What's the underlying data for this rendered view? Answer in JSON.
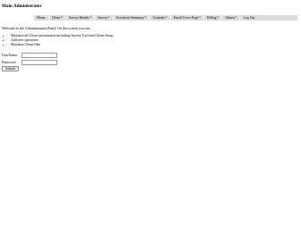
{
  "app": {
    "title": "Main Administrator"
  },
  "nav": {
    "items": [
      {
        "label": "Home",
        "has_caret": false
      },
      {
        "label": "Client",
        "has_caret": true
      },
      {
        "label": "Survey Results",
        "has_caret": true
      },
      {
        "label": "Survey",
        "has_caret": true
      },
      {
        "label": "Executive Summary",
        "has_caret": true
      },
      {
        "label": "Generate",
        "has_caret": true
      },
      {
        "label": "Email Cover Page",
        "has_caret": true
      },
      {
        "label": "Billing",
        "has_caret": true
      },
      {
        "label": "Admin",
        "has_caret": true
      },
      {
        "label": "Log Out",
        "has_caret": false
      }
    ],
    "caret_glyph": "▾"
  },
  "main": {
    "welcome_text": "Welcome to the Administration Panel. On this screen you can:",
    "tasks": [
      "Maintain all Client information including Survey Tool and Client Setup",
      "Add new questions",
      "Maintain Client files"
    ]
  },
  "login": {
    "username_label": "UserName:",
    "username_value": "",
    "password_label": "Password:",
    "password_value": "",
    "submit_label": "Submit"
  }
}
